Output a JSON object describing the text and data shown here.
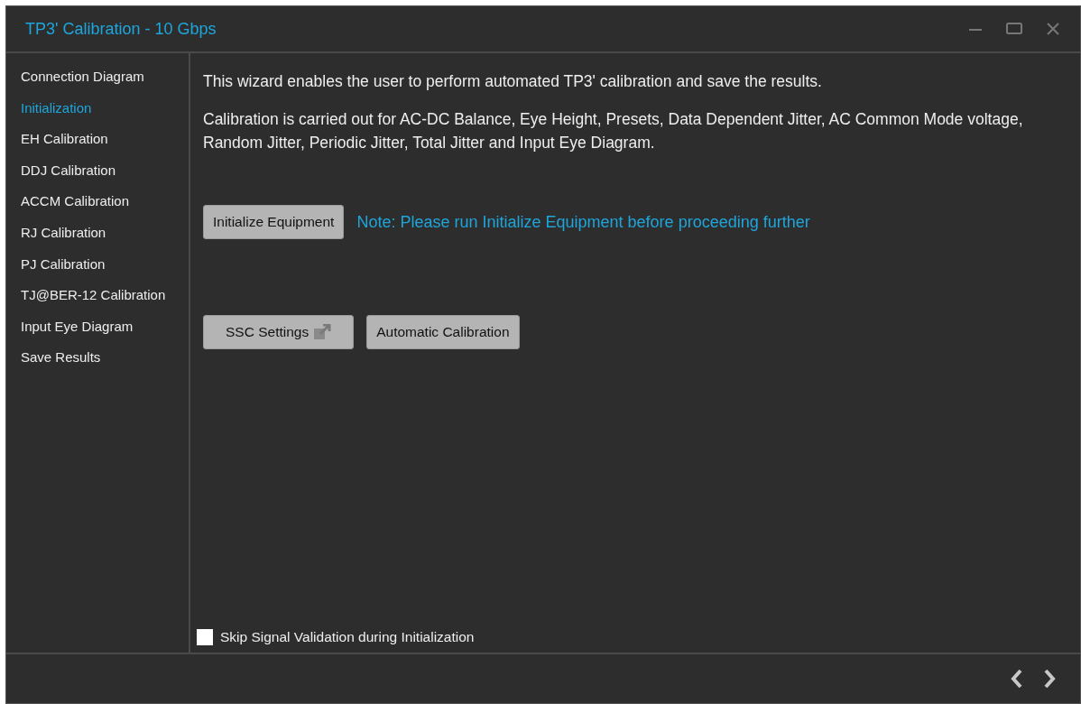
{
  "window": {
    "title": "TP3' Calibration - 10 Gbps"
  },
  "sidebar": {
    "items": [
      {
        "label": "Connection Diagram",
        "selected": false
      },
      {
        "label": "Initialization",
        "selected": true
      },
      {
        "label": "EH Calibration",
        "selected": false
      },
      {
        "label": "DDJ Calibration",
        "selected": false
      },
      {
        "label": "ACCM Calibration",
        "selected": false
      },
      {
        "label": "RJ Calibration",
        "selected": false
      },
      {
        "label": "PJ Calibration",
        "selected": false
      },
      {
        "label": "TJ@BER-12 Calibration",
        "selected": false
      },
      {
        "label": "Input Eye Diagram",
        "selected": false
      },
      {
        "label": "Save Results",
        "selected": false
      }
    ]
  },
  "content": {
    "paragraphs": [
      "This wizard enables the user to perform automated TP3' calibration and save the results.",
      "Calibration is carried out for AC-DC Balance, Eye Height, Presets, Data Dependent Jitter, AC Common Mode voltage, Random Jitter, Periodic Jitter, Total Jitter and Input Eye Diagram."
    ],
    "initialize_button": "Initialize Equipment",
    "note": "Note: Please run Initialize Equipment before proceeding further",
    "buttons": [
      {
        "label": "SSC Settings",
        "kind": "external"
      },
      {
        "label": "Automatic Calibration",
        "kind": "plain"
      }
    ],
    "checkbox": {
      "label": "Skip Signal Validation during Initialization",
      "checked": false
    }
  }
}
